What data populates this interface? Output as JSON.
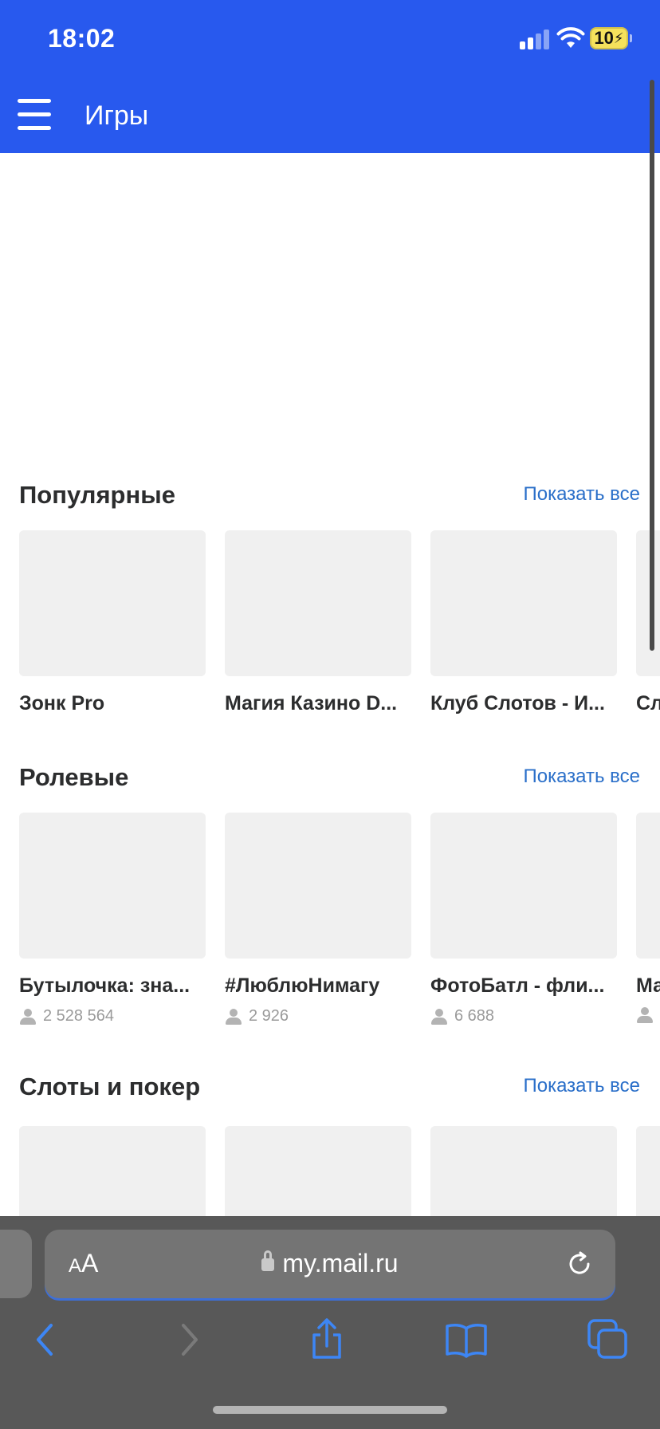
{
  "status_bar": {
    "time": "18:02",
    "battery": "10"
  },
  "app_bar": {
    "title": "Игры",
    "menu_icon": "hamburger-menu-icon",
    "background_color": "#2859ee"
  },
  "sections": [
    {
      "title": "Популярные",
      "show_all": "Показать все",
      "games": [
        {
          "name": "Зонк Pro"
        },
        {
          "name": "Магия Казино D..."
        },
        {
          "name": "Клуб Слотов - И..."
        },
        {
          "name": "Сл"
        }
      ]
    },
    {
      "title": "Ролевые",
      "show_all": "Показать все",
      "games": [
        {
          "name": "Бутылочка: зна...",
          "players": "2 528 564"
        },
        {
          "name": "#ЛюблюНимагу",
          "players": "2 926"
        },
        {
          "name": "ФотоБатл - фли...",
          "players": "6 688"
        },
        {
          "name": "Ма",
          "players": ""
        }
      ]
    },
    {
      "title": "Слоты и покер",
      "show_all": "Показать все",
      "games": []
    }
  ],
  "browser": {
    "text_size_label_small": "A",
    "text_size_label_large": "A",
    "url": "my.mail.ru",
    "toolbar_icons": [
      "back-icon",
      "forward-icon",
      "share-icon",
      "bookmarks-icon",
      "tabs-icon"
    ]
  },
  "colors": {
    "accent": "#2859ee",
    "link": "#2a6fc9",
    "placeholder": "#f0f0f0",
    "browser_bar": "#585858"
  }
}
